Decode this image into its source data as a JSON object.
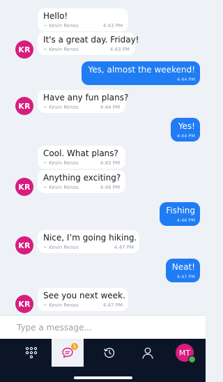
{
  "messages": [
    {
      "text": "Hello!",
      "sender": "~ Kevin Renos",
      "time": "4:43 PM"
    },
    {
      "avatar": "KR",
      "text": "It's a great day. Friday!",
      "sender": "~ Kevin Renos",
      "time": "4:43 PM"
    },
    {
      "text": "Yes, almost the weekend!",
      "time": "4:44 PM"
    },
    {
      "avatar": "KR",
      "text": "Have any fun plans?",
      "sender": "~ Kevin Renos",
      "time": "4:44 PM"
    },
    {
      "text": "Yes!",
      "time": "4:44 PM"
    },
    {
      "text": "Cool. What plans?",
      "sender": "~ Kevin Renos",
      "time": "4:45 PM"
    },
    {
      "avatar": "KR",
      "text": "Anything exciting?",
      "sender": "~ Kevin Renos",
      "time": "4:46 PM"
    },
    {
      "text": "Fishing",
      "time": "4:46 PM"
    },
    {
      "avatar": "KR",
      "text": "Nice, I’m going hiking.",
      "sender": "~ Kevin Renos",
      "time": "4:47 PM"
    },
    {
      "text": "Neat!",
      "time": "4:47 PM"
    },
    {
      "avatar": "KR",
      "text": "See you next week.",
      "sender": "~ Kevin Renos",
      "time": "4:47 PM"
    }
  ],
  "composer": {
    "placeholder": "Type a message..."
  },
  "tabbar": {
    "items": [
      {
        "icon": "apps-grid-icon"
      },
      {
        "icon": "chat-bubble-icon",
        "badge": "1",
        "active": true
      },
      {
        "icon": "history-icon"
      },
      {
        "icon": "person-icon"
      },
      {
        "icon": "profile-avatar",
        "initials": "MT",
        "status": "online"
      }
    ]
  },
  "colors": {
    "background": "#eef1f6",
    "outgoing_bubble": "#1f7cf3",
    "avatar": "#d71d7e",
    "tabbar": "#0b1527",
    "badge": "#f5a524",
    "online": "#4caf50"
  }
}
